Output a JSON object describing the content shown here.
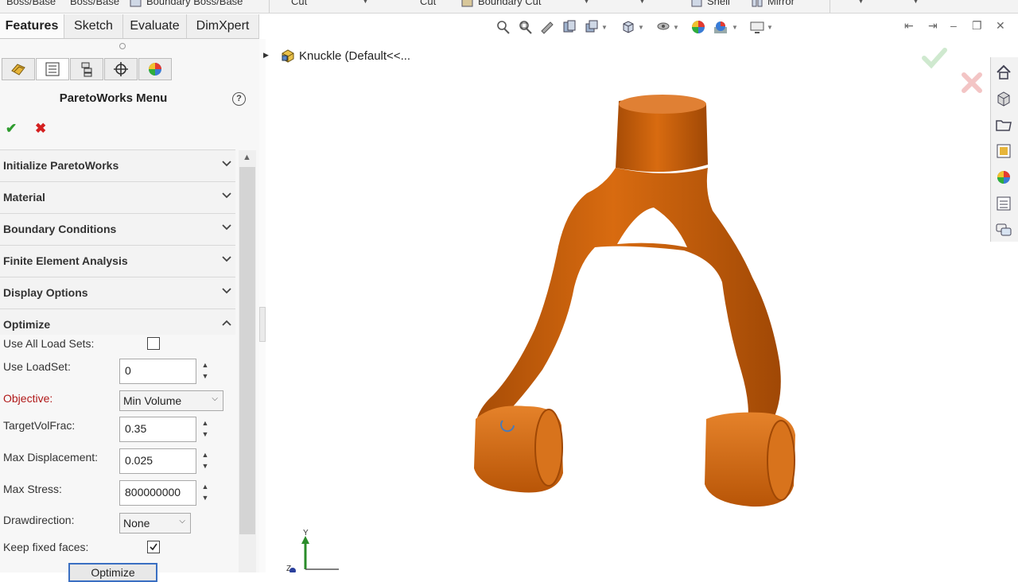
{
  "ribbon": {
    "items": [
      "Boss/Base",
      "Boss/Base",
      "Boundary Boss/Base",
      "Cut",
      "Cut",
      "Boundary Cut",
      "Shell",
      "Mirror"
    ]
  },
  "tabs": [
    "Features",
    "Sketch",
    "Evaluate",
    "DimXpert"
  ],
  "panel": {
    "title": "ParetoWorks Menu",
    "help": "?",
    "groups": [
      "Initialize ParetoWorks",
      "Material",
      "Boundary Conditions",
      "Finite Element Analysis",
      "Display Options",
      "Optimize"
    ],
    "optimize": {
      "use_all_load_sets_label": "Use All Load Sets:",
      "use_all_load_sets_checked": false,
      "use_loadset_label": "Use LoadSet:",
      "use_loadset_value": "0",
      "objective_label": "Objective:",
      "objective_value": "Min Volume",
      "target_vol_frac_label": "TargetVolFrac:",
      "target_vol_frac_value": "0.35",
      "max_displacement_label": "Max Displacement:",
      "max_displacement_value": "0.025",
      "max_stress_label": "Max Stress:",
      "max_stress_value": "800000000",
      "drawdirection_label": "Drawdirection:",
      "drawdirection_value": "None",
      "keep_fixed_faces_label": "Keep fixed faces:",
      "keep_fixed_faces_checked": true,
      "optimize_button": "Optimize"
    }
  },
  "tree": {
    "label": "Knuckle  (Default<<..."
  },
  "triad": {
    "y": "Y",
    "z": "Z"
  },
  "colors": {
    "part": "#c95f0a",
    "accept": "#2e9b2e",
    "cancel": "#d42020",
    "objective_label": "#b01818"
  }
}
